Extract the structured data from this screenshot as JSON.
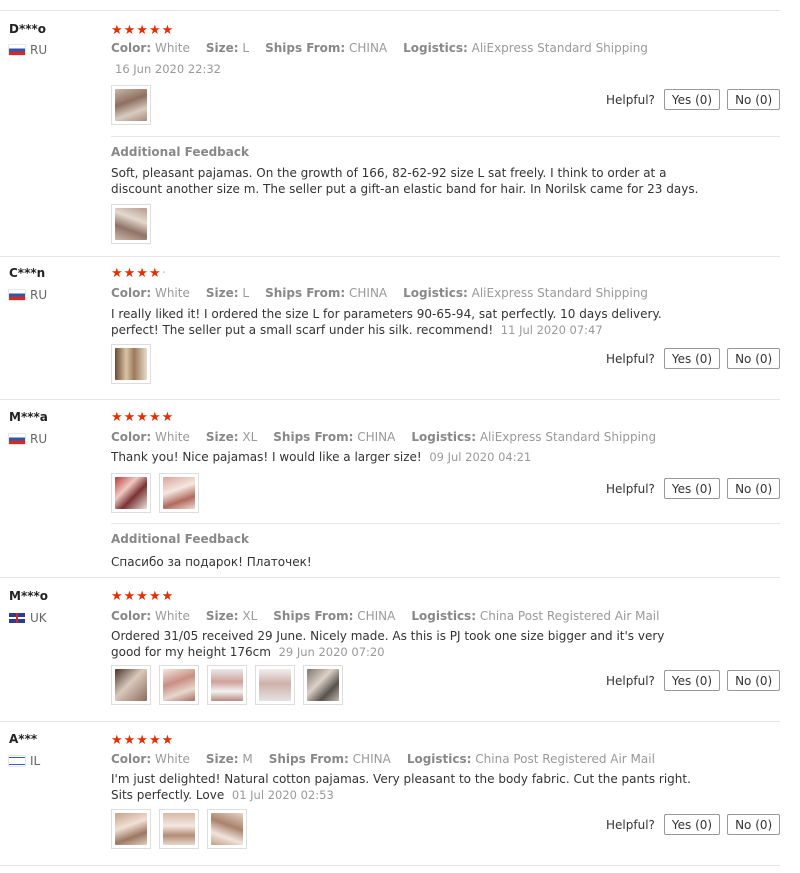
{
  "reviews": [
    {
      "user": "D***o",
      "country": "RU",
      "attrs": {
        "color_label": "Color:",
        "color": "White",
        "size_label": "Size:",
        "size": "L",
        "ships_label": "Ships From:",
        "ships": "CHINA",
        "logistics_label": "Logistics:",
        "logistics": "AliExpress Standard Shipping"
      },
      "date": "16 Jun 2020 22:32",
      "text": "",
      "helpful": {
        "label": "Helpful?",
        "yes": "Yes (0)",
        "no": "No (0)"
      },
      "additional": {
        "title": "Additional Feedback",
        "text": "Soft, pleasant pajamas. On the growth of 166, 82-62-92 size L sat freely. I think to order at a discount another size m. The seller put a gift-an elastic band for hair. In Norilsk came for 23 days."
      }
    },
    {
      "user": "C***n",
      "country": "RU",
      "attrs": {
        "color_label": "Color:",
        "color": "White",
        "size_label": "Size:",
        "size": "L",
        "ships_label": "Ships From:",
        "ships": "CHINA",
        "logistics_label": "Logistics:",
        "logistics": "AliExpress Standard Shipping"
      },
      "text": "I really liked it! I ordered the size L for parameters 90-65-94, sat perfectly. 10 days delivery. perfect! The seller put a small scarf under his silk. recommend!",
      "date": "11 Jul 2020 07:47",
      "helpful": {
        "label": "Helpful?",
        "yes": "Yes (0)",
        "no": "No (0)"
      }
    },
    {
      "user": "M***a",
      "country": "RU",
      "attrs": {
        "color_label": "Color:",
        "color": "White",
        "size_label": "Size:",
        "size": "XL",
        "ships_label": "Ships From:",
        "ships": "CHINA",
        "logistics_label": "Logistics:",
        "logistics": "AliExpress Standard Shipping"
      },
      "text": "Thank you! Nice pajamas! I would like a larger size!",
      "date": "09 Jul 2020 04:21",
      "helpful": {
        "label": "Helpful?",
        "yes": "Yes (0)",
        "no": "No (0)"
      },
      "additional": {
        "title": "Additional Feedback",
        "text": "Спасибо за подарок! Платочек!"
      }
    },
    {
      "user": "M***o",
      "country": "UK",
      "attrs": {
        "color_label": "Color:",
        "color": "White",
        "size_label": "Size:",
        "size": "XL",
        "ships_label": "Ships From:",
        "ships": "CHINA",
        "logistics_label": "Logistics:",
        "logistics": "China Post Registered Air Mail"
      },
      "text": "Ordered 31/05 received 29 June. Nicely made. As this is PJ took one size bigger and it's very good for my height 176cm",
      "date": "29 Jun 2020 07:20",
      "helpful": {
        "label": "Helpful?",
        "yes": "Yes (0)",
        "no": "No (0)"
      }
    },
    {
      "user": "A***",
      "country": "IL",
      "attrs": {
        "color_label": "Color:",
        "color": "White",
        "size_label": "Size:",
        "size": "M",
        "ships_label": "Ships From:",
        "ships": "CHINA",
        "logistics_label": "Logistics:",
        "logistics": "China Post Registered Air Mail"
      },
      "text": "I'm just delighted! Natural cotton pajamas. Very pleasant to the body fabric. Cut the pants right. Sits perfectly. Love",
      "date": "01 Jul 2020 02:53",
      "helpful": {
        "label": "Helpful?",
        "yes": "Yes (0)",
        "no": "No (0)"
      }
    }
  ],
  "ratings": [
    5,
    4.5,
    5,
    5,
    5
  ],
  "colors": {
    "star": "#e62e04",
    "separator": "#e6e6e6",
    "muted_text": "#999999"
  }
}
